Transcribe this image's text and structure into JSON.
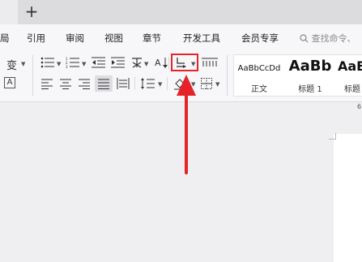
{
  "tabbar": {
    "new_tab": "+"
  },
  "menu": [
    "局",
    "引用",
    "审阅",
    "视图",
    "章节",
    "开发工具",
    "会员专享"
  ],
  "search": {
    "placeholder": "查找命令、"
  },
  "ribbon": {
    "phonetic_glyph": "变",
    "border_char_glyph": "A",
    "styles": [
      {
        "preview": "AaBbCcDd",
        "name": "正文"
      },
      {
        "preview": "AaBb",
        "name": "标题 1"
      },
      {
        "preview": "AaBb",
        "name": "标题"
      }
    ]
  },
  "ruler": {
    "label": "6"
  },
  "annotation": {
    "highlight_color": "#e5242a",
    "target": "line-spacing-button"
  }
}
